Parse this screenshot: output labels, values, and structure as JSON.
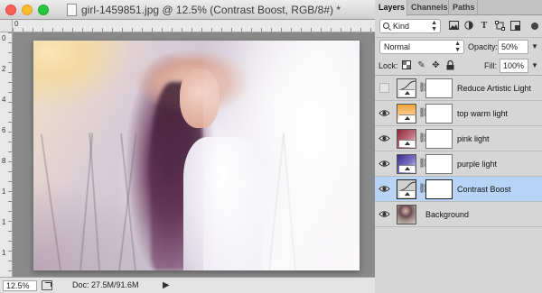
{
  "document": {
    "title": "girl-1459851.jpg @ 12.5% (Contrast Boost, RGB/8#) *",
    "ruler_top_start": "0",
    "ruler_left_marks": [
      "0",
      "2",
      "4",
      "6",
      "8",
      "1",
      "1",
      "1"
    ],
    "status": {
      "zoom": "12.5%",
      "doc_info": "Doc: 27.5M/91.6M",
      "arrow": "▶"
    }
  },
  "panel": {
    "tabs": [
      {
        "label": "Layers",
        "active": true
      },
      {
        "label": "Channels",
        "active": false
      },
      {
        "label": "Paths",
        "active": false
      }
    ],
    "filter": {
      "kind_label": "Kind",
      "icons": [
        "image-filter-icon",
        "adjustment-filter-icon",
        "type-filter-icon",
        "shape-filter-icon",
        "smart-object-filter-icon"
      ]
    },
    "blend_mode": "Normal",
    "opacity_label": "Opacity:",
    "opacity_value": "50%",
    "lock_label": "Lock:",
    "fill_label": "Fill:",
    "fill_value": "100%",
    "layers": [
      {
        "name": "Reduce Artistic Light",
        "visible": false,
        "selected": false,
        "thumb": "curves",
        "color": "#d9d9d9"
      },
      {
        "name": "top warm light",
        "visible": true,
        "selected": false,
        "thumb": "gradient",
        "color": "#f2a23a"
      },
      {
        "name": "pink light",
        "visible": true,
        "selected": false,
        "thumb": "gradient",
        "color": "#8c2436"
      },
      {
        "name": "purple light",
        "visible": true,
        "selected": false,
        "thumb": "gradient",
        "color": "#3c2f8e"
      },
      {
        "name": "Contrast Boost",
        "visible": true,
        "selected": true,
        "thumb": "curves",
        "color": "#cfcfcf"
      },
      {
        "name": "Background",
        "visible": true,
        "selected": false,
        "thumb": "photo",
        "color": "#9c8d86"
      }
    ]
  }
}
